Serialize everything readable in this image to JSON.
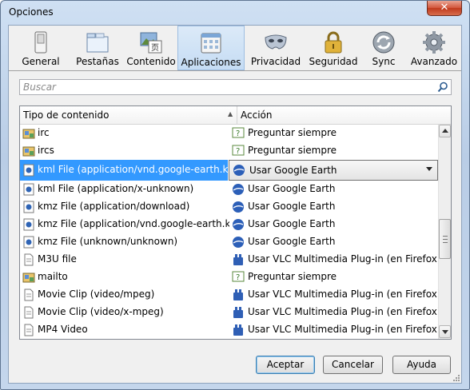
{
  "window": {
    "title": "Opciones"
  },
  "toolbar": {
    "tabs": [
      {
        "label": "General",
        "icon": "general-icon"
      },
      {
        "label": "Pestañas",
        "icon": "tabs-icon"
      },
      {
        "label": "Contenido",
        "icon": "content-icon"
      },
      {
        "label": "Aplicaciones",
        "icon": "applications-icon",
        "selected": true
      },
      {
        "label": "Privacidad",
        "icon": "privacy-mask-icon"
      },
      {
        "label": "Seguridad",
        "icon": "padlock-icon"
      },
      {
        "label": "Sync",
        "icon": "sync-icon"
      },
      {
        "label": "Avanzado",
        "icon": "gear-icon"
      }
    ]
  },
  "search": {
    "placeholder": "Buscar"
  },
  "table": {
    "columns": {
      "content_type": "Tipo de contenido",
      "action": "Acción"
    },
    "rows": [
      {
        "type": "irc",
        "action": "Preguntar siempre"
      },
      {
        "type": "ircs",
        "action": "Preguntar siempre"
      },
      {
        "type": "kml File (application/vnd.google-earth.km...",
        "action": "Usar Google Earth",
        "selected": true
      },
      {
        "type": "kml File (application/x-unknown)",
        "action": "Usar Google Earth"
      },
      {
        "type": "kmz File (application/download)",
        "action": "Usar Google Earth"
      },
      {
        "type": "kmz File (application/vnd.google-earth.k...",
        "action": "Usar Google Earth"
      },
      {
        "type": "kmz File (unknown/unknown)",
        "action": "Usar Google Earth"
      },
      {
        "type": "M3U file",
        "action": "Usar VLC Multimedia Plug-in (en Firefox)"
      },
      {
        "type": "mailto",
        "action": "Preguntar siempre"
      },
      {
        "type": "Movie Clip (video/mpeg)",
        "action": "Usar VLC Multimedia Plug-in (en Firefox)"
      },
      {
        "type": "Movie Clip (video/x-mpeg)",
        "action": "Usar VLC Multimedia Plug-in (en Firefox)"
      },
      {
        "type": "MP4 Video",
        "action": "Usar VLC Multimedia Plug-in (en Firefox)"
      }
    ]
  },
  "buttons": {
    "accept": "Aceptar",
    "cancel": "Cancelar",
    "help": "Ayuda"
  },
  "colors": {
    "selection": "#3399ff",
    "window_frame": "#b9cde6"
  }
}
